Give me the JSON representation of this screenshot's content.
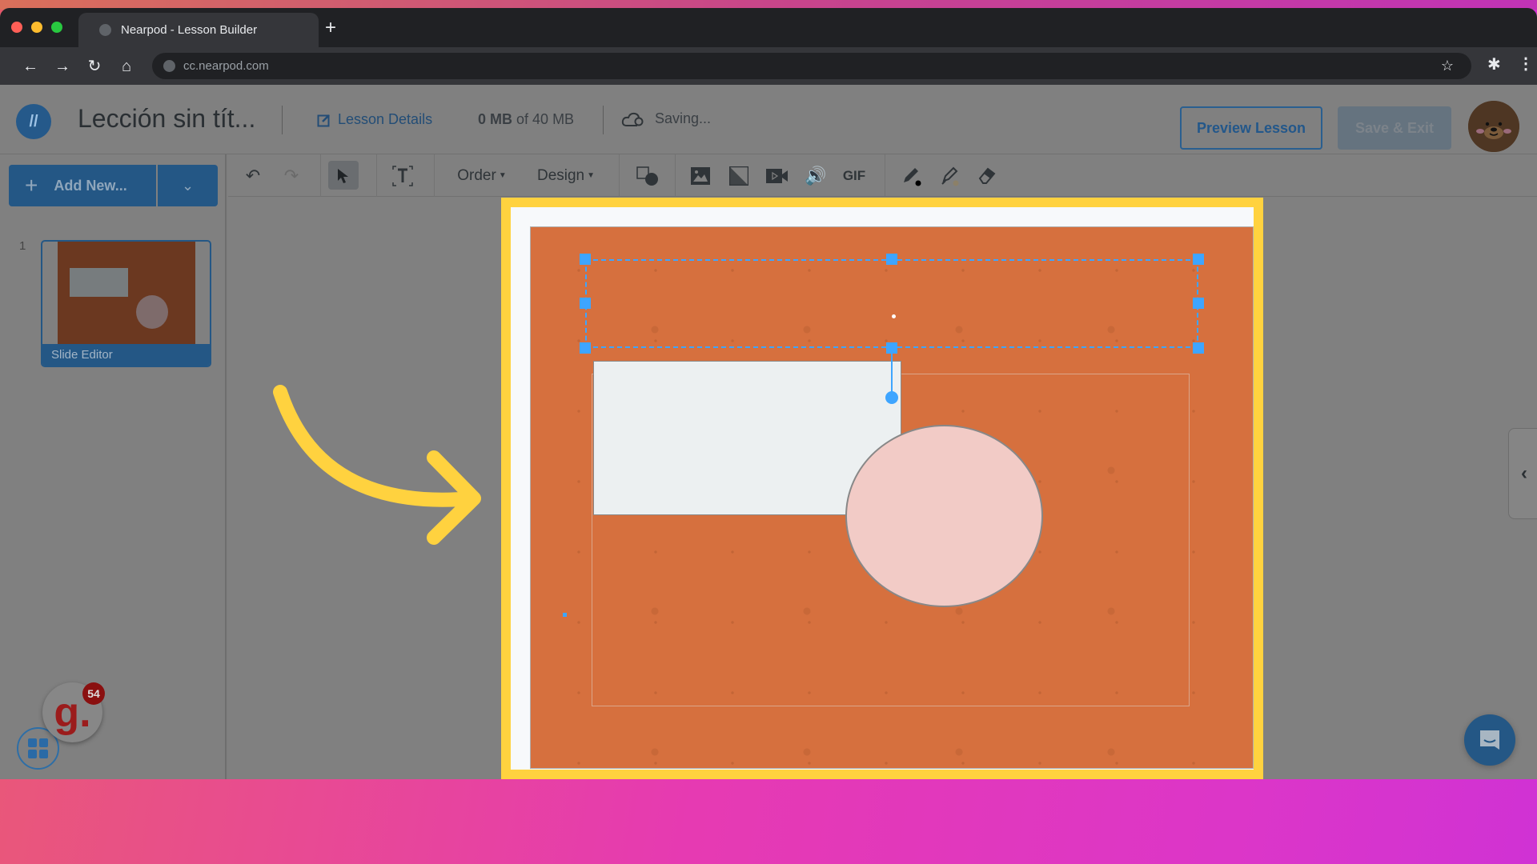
{
  "browser": {
    "tab_title": "Nearpod - Lesson Builder",
    "new_tab_symbol": "+",
    "url": "cc.nearpod.com",
    "icons": {
      "back": "arrow-left-icon",
      "forward": "arrow-right-icon",
      "reload": "reload-icon",
      "home": "home-icon",
      "site_info": "globe-icon",
      "bookmark": "star-icon",
      "extensions": "puzzle-icon",
      "menu": "kebab-menu-icon"
    }
  },
  "header": {
    "lesson_title": "Lección sin tít...",
    "lesson_details_label": "Lesson Details",
    "storage_used": "0 MB",
    "storage_of": "of 40 MB",
    "save_status": "Saving...",
    "preview_label": "Preview Lesson",
    "save_exit_label": "Save & Exit"
  },
  "sidebar": {
    "add_new_label": "Add New...",
    "slides": [
      {
        "number": "1",
        "label": "Slide Editor"
      }
    ],
    "gimkit_badge_count": "54",
    "gimkit_letter": "g."
  },
  "toolbar": {
    "order_label": "Order",
    "design_label": "Design",
    "gif_label": "GIF",
    "tools": [
      "undo",
      "redo",
      "select",
      "text",
      "order",
      "design",
      "shapes",
      "image",
      "background",
      "video",
      "audio",
      "gif",
      "pen",
      "highlighter",
      "eraser"
    ]
  },
  "canvas": {
    "background_color": "#d6703e",
    "frame_highlight_color": "#ffd23f",
    "selection_color": "#3ea5ff",
    "shapes": [
      {
        "type": "rectangle",
        "fill": "#ecf0f1"
      },
      {
        "type": "circle",
        "fill": "#f2cbc6"
      },
      {
        "type": "text-box",
        "selected": true,
        "content": ""
      }
    ]
  },
  "annotation": {
    "arrow_color": "#ffd23f",
    "points_to": "slide-canvas"
  }
}
